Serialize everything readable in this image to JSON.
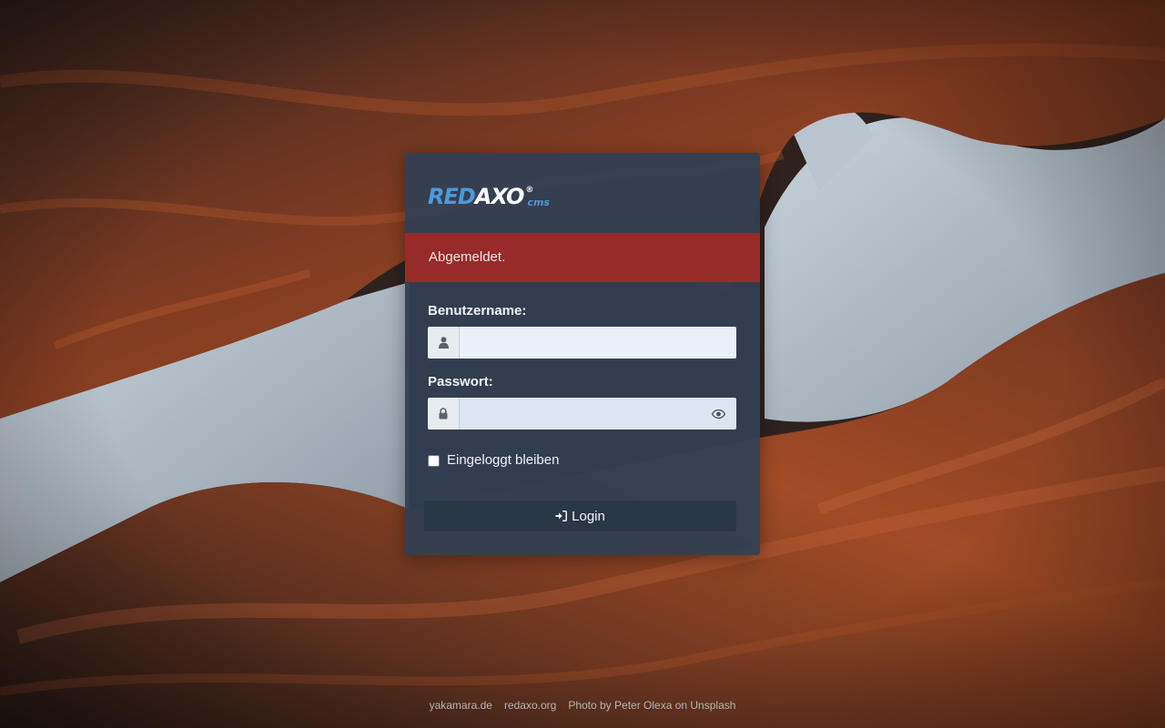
{
  "logo": {
    "part1": "RED",
    "part2": "AXO",
    "registered": "®",
    "suffix": "cms",
    "accent_color": "#4b9ad9"
  },
  "alert": {
    "message": "Abgemeldet.",
    "color": "#972b2a"
  },
  "form": {
    "username": {
      "label": "Benutzername:",
      "value": "",
      "placeholder": "",
      "icon": "user-icon"
    },
    "password": {
      "label": "Passwort:",
      "value": "",
      "placeholder": "",
      "icon": "lock-icon",
      "reveal_icon": "eye-icon"
    },
    "remember": {
      "label": "Eingeloggt bleiben",
      "checked": false
    },
    "submit": {
      "label": "Login",
      "icon": "sign-in-icon"
    }
  },
  "footer": {
    "links": [
      "yakamara.de",
      "redaxo.org",
      "Photo by Peter Olexa on Unsplash"
    ]
  }
}
